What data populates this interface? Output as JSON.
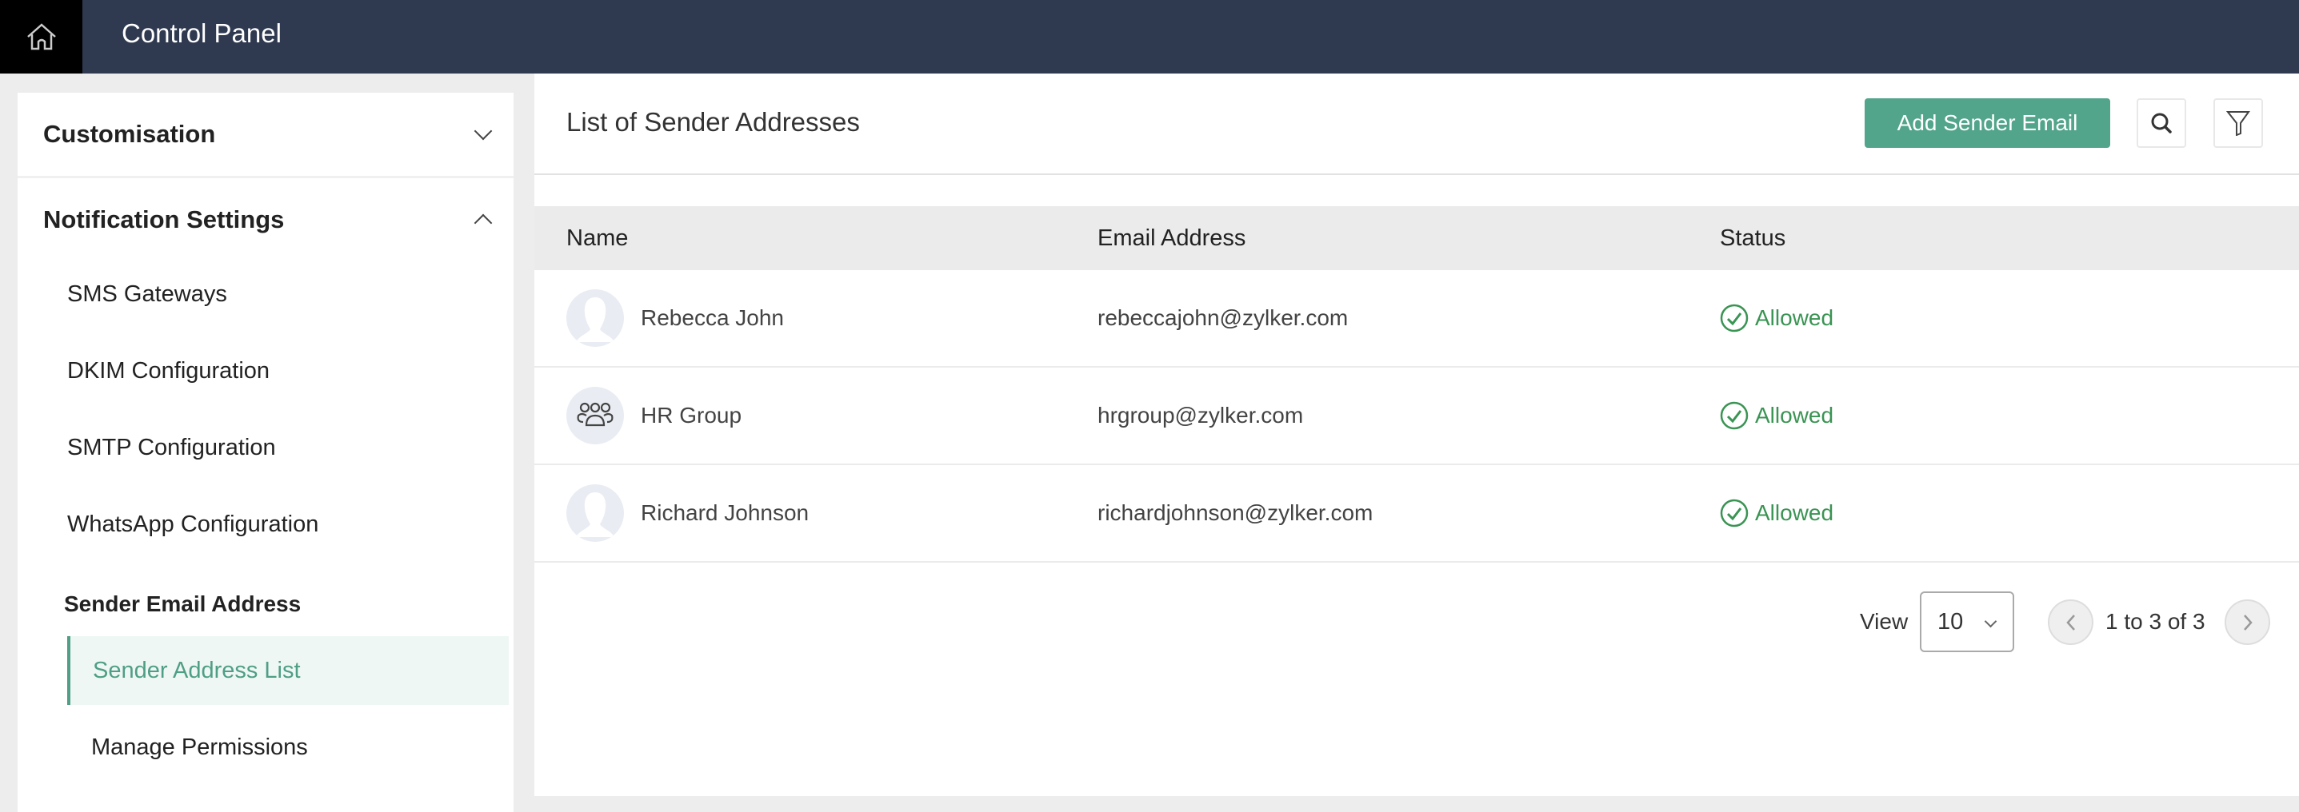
{
  "header": {
    "title": "Control Panel",
    "home_icon": "home-icon"
  },
  "sidebar": {
    "sections": [
      {
        "label": "Customisation",
        "expanded": false
      },
      {
        "label": "Notification Settings",
        "expanded": true
      }
    ],
    "items": [
      {
        "label": "SMS Gateways"
      },
      {
        "label": "DKIM Configuration"
      },
      {
        "label": "SMTP Configuration"
      },
      {
        "label": "WhatsApp Configuration"
      }
    ],
    "subgroup": {
      "label": "Sender Email Address",
      "items": [
        {
          "label": "Sender Address List",
          "active": true
        },
        {
          "label": "Manage Permissions",
          "active": false
        }
      ]
    }
  },
  "main": {
    "title": "List of Sender Addresses",
    "add_button": "Add Sender Email",
    "search_icon": "search-icon",
    "filter_icon": "filter-icon",
    "accent": "#52a48a",
    "table": {
      "columns": [
        "Name",
        "Email Address",
        "Status"
      ],
      "rows": [
        {
          "name": "Rebecca John",
          "email": "rebeccajohn@zylker.com",
          "status": "Allowed",
          "avatar": "user-avatar"
        },
        {
          "name": "HR Group",
          "email": "hrgroup@zylker.com",
          "status": "Allowed",
          "avatar": "group-avatar"
        },
        {
          "name": "Richard Johnson",
          "email": "richardjohnson@zylker.com",
          "status": "Allowed",
          "avatar": "user-avatar"
        }
      ],
      "status_color": "#3a9453"
    },
    "pagination": {
      "view_label": "View",
      "page_size": "10",
      "range_text": "1 to 3 of 3"
    }
  }
}
